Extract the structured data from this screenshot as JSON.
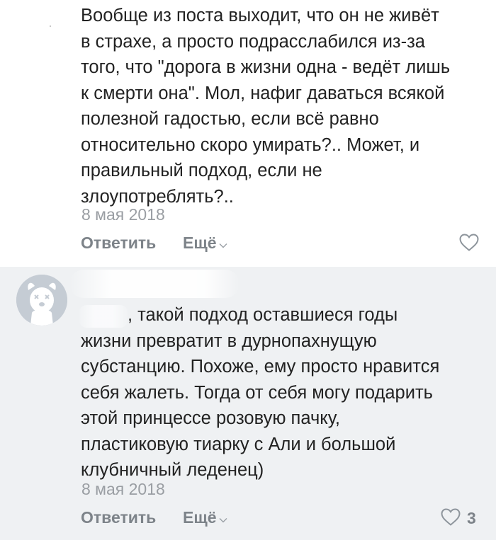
{
  "comments": [
    {
      "text": "Вообще из поста выходит, что он не живёт\nв страхе, а просто подрасслабился из-за\nтого, что \"дорога в жизни одна - ведёт лишь\nк смерти она\". Мол, нафиг даваться всякой\nполезной гадостью, если всё равно\nотносительно скоро умирать?.. Может, и\nправильный подход, если не\nзлоупотреблять?..",
      "date": "8 мая 2018",
      "reply_label": "Ответить",
      "more_label": "Ещё",
      "likes": ""
    },
    {
      "text": ", такой подход оставшиеся годы\nжизни превратит в дурнопахнущую\nсубстанцию. Похоже, ему просто нравится\nсебя жалеть. Тогда от себя могу подарить\nэтой принцессе розовую пачку,\nпластиковую тиарку с Али и большой\nклубничный леденец)",
      "date": "8 мая 2018",
      "reply_label": "Ответить",
      "more_label": "Ещё",
      "likes": "3"
    }
  ],
  "colors": {
    "text": "#222222",
    "meta": "#9a9ea3",
    "action": "#7d8389",
    "reply_background": "#eff1f3",
    "avatar_background": "#c5ccd4"
  },
  "icons": {
    "like": "heart-outline-icon",
    "more": "chevron-down-icon",
    "avatar": "deactivated-dog-avatar-icon"
  }
}
